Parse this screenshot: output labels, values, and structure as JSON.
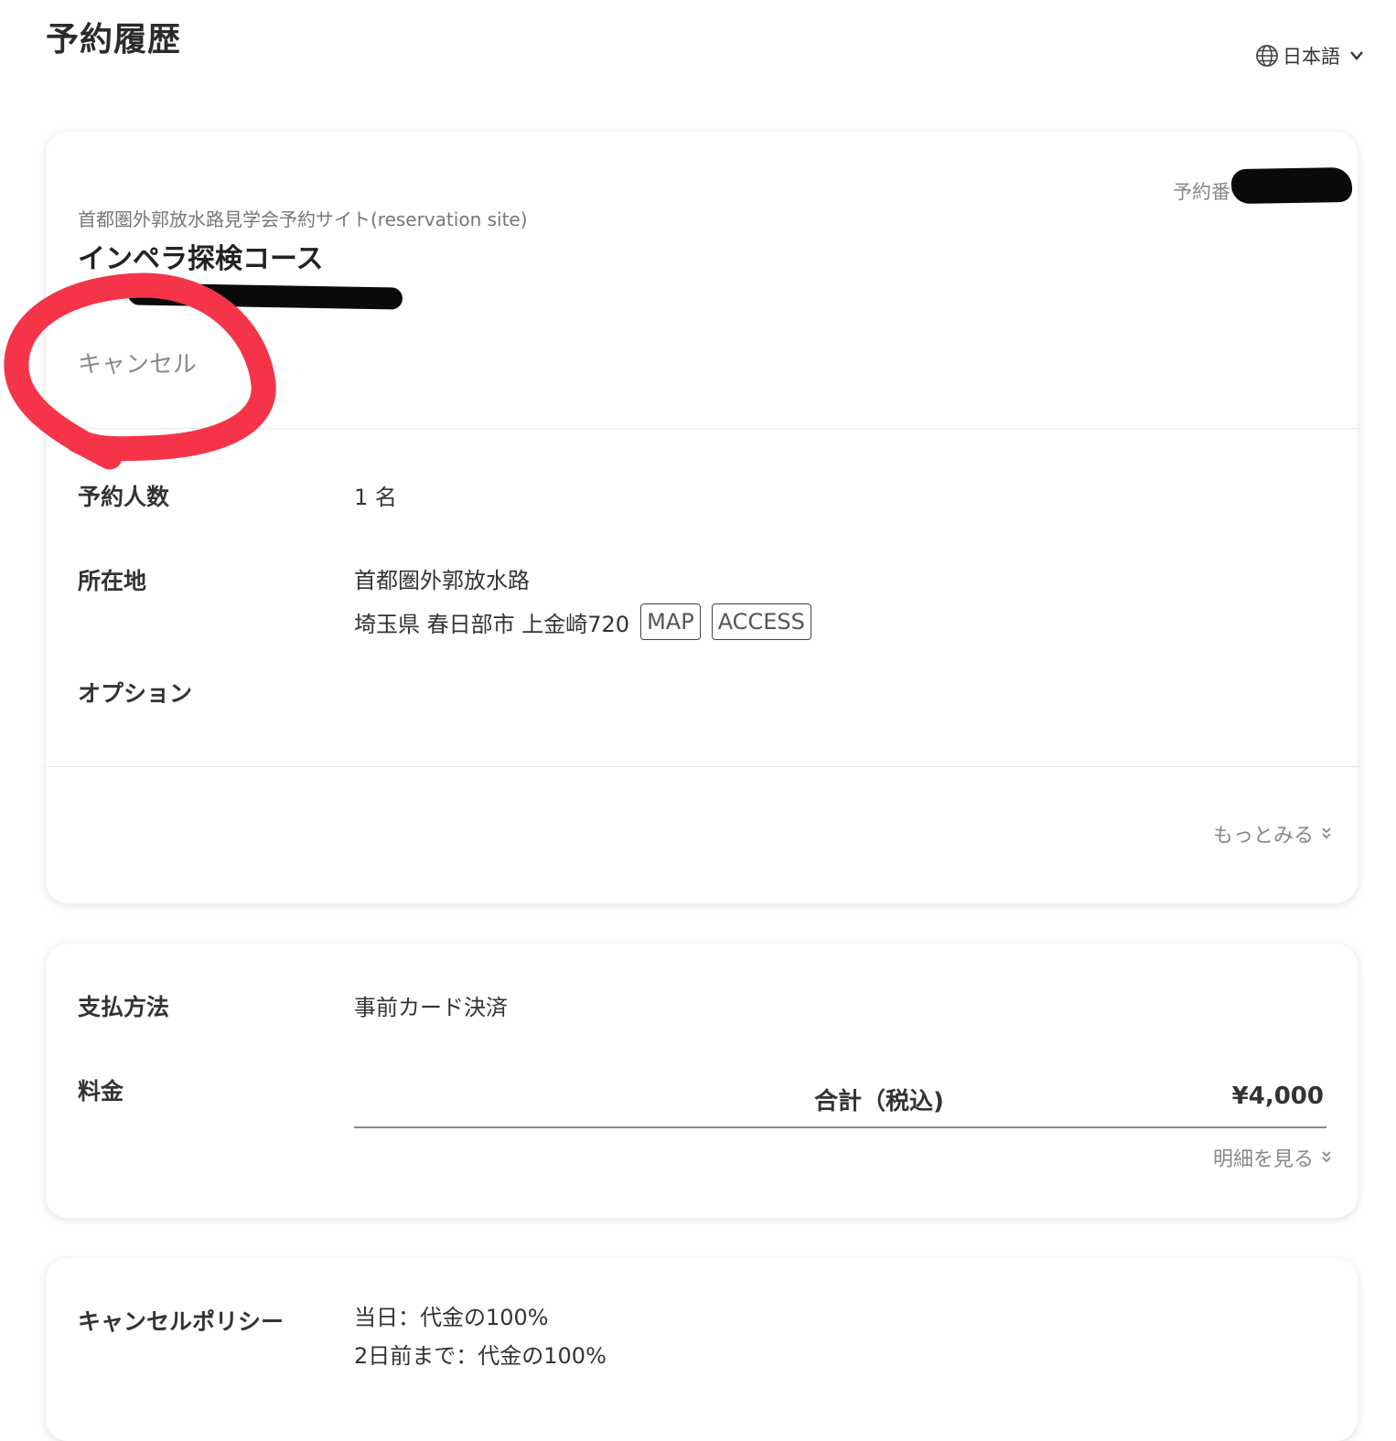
{
  "page": {
    "title": "予約履歴"
  },
  "header": {
    "language_label": "日本語",
    "language_icon": "globe-icon",
    "dropdown_icon": "chevron-down-icon"
  },
  "reservation": {
    "number_label": "予約番号",
    "site_name": "首都圏外郭放水路見学会予約サイト(reservation site)",
    "course_title": "インペラ探検コース",
    "status": "キャンセル",
    "fields": {
      "people_label": "予約人数",
      "people_value": "1 名",
      "location_label": "所在地",
      "location_name": "首都圏外郭放水路",
      "location_address": "埼玉県 春日部市 上金崎720",
      "map_button": "MAP",
      "access_button": "ACCESS",
      "options_label": "オプション"
    },
    "more_label": "もっとみる"
  },
  "payment": {
    "method_label": "支払方法",
    "method_value": "事前カード決済",
    "fee_label": "料金",
    "total_label": "合計（税込)",
    "total_value": "¥4,000",
    "details_label": "明細を見る"
  },
  "policy": {
    "label": "キャンセルポリシー",
    "lines": [
      "当日：代金の100%",
      "2日前まで：代金の100%"
    ]
  },
  "colors": {
    "annotation": "#f5344a",
    "redaction": "#0a0a0a",
    "muted_text": "#888888"
  }
}
